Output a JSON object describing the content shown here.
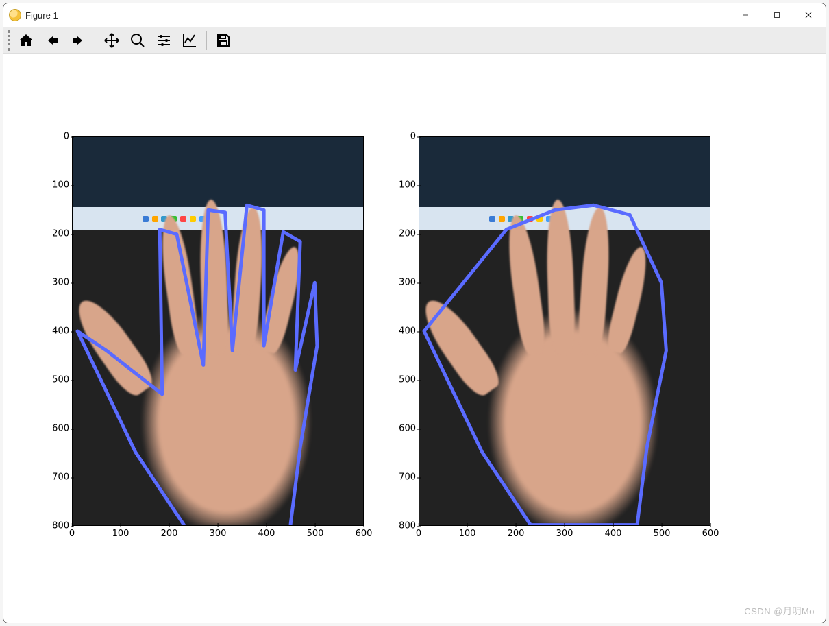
{
  "window": {
    "title": "Figure 1",
    "controls": {
      "minimize": "—",
      "maximize": "□",
      "close": "×"
    }
  },
  "toolbar": {
    "buttons": [
      {
        "name": "home",
        "tip": "Reset original view"
      },
      {
        "name": "back",
        "tip": "Back to previous view"
      },
      {
        "name": "forward",
        "tip": "Forward to next view"
      },
      {
        "name": "pan",
        "tip": "Pan"
      },
      {
        "name": "zoom",
        "tip": "Zoom"
      },
      {
        "name": "subplots",
        "tip": "Configure subplots"
      },
      {
        "name": "edit",
        "tip": "Edit axis"
      },
      {
        "name": "save",
        "tip": "Save the figure"
      }
    ]
  },
  "watermark": "CSDN @月明Mo",
  "chart_data": [
    {
      "type": "image-overlay",
      "image_extent": {
        "x": [
          0,
          600
        ],
        "y": [
          0,
          800
        ]
      },
      "x_ticks": [
        0,
        100,
        200,
        300,
        400,
        500,
        600
      ],
      "y_ticks": [
        0,
        100,
        200,
        300,
        400,
        500,
        600,
        700,
        800
      ],
      "overlay_polyline": [
        [
          230,
          800
        ],
        [
          130,
          650
        ],
        [
          10,
          400
        ],
        [
          70,
          440
        ],
        [
          185,
          530
        ],
        [
          180,
          190
        ],
        [
          215,
          200
        ],
        [
          270,
          470
        ],
        [
          280,
          150
        ],
        [
          315,
          155
        ],
        [
          330,
          440
        ],
        [
          360,
          140
        ],
        [
          395,
          150
        ],
        [
          395,
          430
        ],
        [
          435,
          195
        ],
        [
          470,
          215
        ],
        [
          460,
          480
        ],
        [
          500,
          300
        ],
        [
          505,
          430
        ],
        [
          470,
          640
        ],
        [
          450,
          800
        ]
      ],
      "overlay_color": "#5a6bff",
      "description": "Concave hand landmark contour overlay"
    },
    {
      "type": "image-overlay",
      "image_extent": {
        "x": [
          0,
          600
        ],
        "y": [
          0,
          800
        ]
      },
      "x_ticks": [
        0,
        100,
        200,
        300,
        400,
        500,
        600
      ],
      "y_ticks": [
        0,
        100,
        200,
        300,
        400,
        500,
        600,
        700,
        800
      ],
      "overlay_polygon": [
        [
          230,
          800
        ],
        [
          130,
          650
        ],
        [
          10,
          400
        ],
        [
          180,
          190
        ],
        [
          280,
          150
        ],
        [
          360,
          140
        ],
        [
          435,
          160
        ],
        [
          500,
          300
        ],
        [
          510,
          440
        ],
        [
          470,
          640
        ],
        [
          450,
          800
        ]
      ],
      "overlay_color": "#5a6bff",
      "description": "Convex hull of hand landmarks overlay"
    }
  ]
}
